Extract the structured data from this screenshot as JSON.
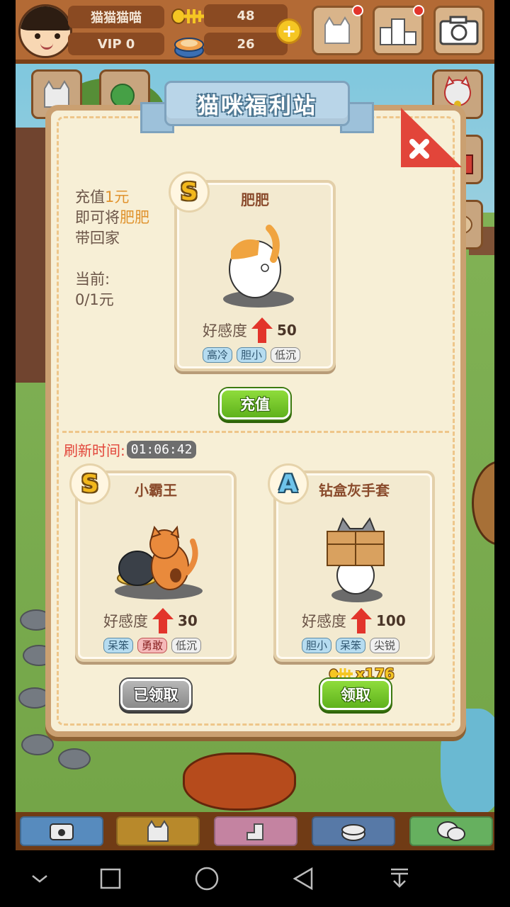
{
  "player": {
    "name": "猫猫猫喵",
    "vip": "VIP 0",
    "fishbone": "48",
    "cans": "26"
  },
  "modal": {
    "title": "猫咪福利站",
    "promo": {
      "line1_a": "充值",
      "line1_b": "1元",
      "line2_a": "即可将",
      "line2_b": "肥肥",
      "line3": "带回家",
      "progress_label": "当前:",
      "progress_value": "0/1元"
    },
    "featured": {
      "grade": "S",
      "name": "肥肥",
      "affinity_label": "好感度",
      "affinity_value": "50",
      "tags": [
        "高冷",
        "胆小",
        "低沉"
      ],
      "button": "充值"
    },
    "refresh_label": "刷新时间:",
    "refresh_time": "01:06:42",
    "cards": [
      {
        "grade": "S",
        "name": "小霸王",
        "affinity_label": "好感度",
        "affinity_value": "30",
        "tags": [
          "呆笨",
          "勇敢",
          "低沉"
        ],
        "button": "已领取"
      },
      {
        "grade": "A",
        "name": "钻盒灰手套",
        "affinity_label": "好感度",
        "affinity_value": "100",
        "tags": [
          "胆小",
          "呆笨",
          "尖锐"
        ],
        "cost": "x176",
        "button": "领取"
      }
    ]
  },
  "colors": {
    "panel_bg": "#f7efd6",
    "panel_border": "#caa071",
    "green_button": "#6cc226",
    "gray_button": "#9a9a9a",
    "highlight_text": "#e0932e",
    "refresh_text": "#e2453a"
  },
  "icons": {
    "fishbone": "fishbone-icon",
    "cans": "cat-food-can-icon",
    "add": "plus-icon",
    "cat_menu": "cat-icon",
    "ranking": "podium-icon",
    "camera": "camera-icon",
    "lucky_cat": "lucky-cat-icon",
    "close": "close-icon",
    "affinity_up": "red-up-arrow-icon"
  }
}
